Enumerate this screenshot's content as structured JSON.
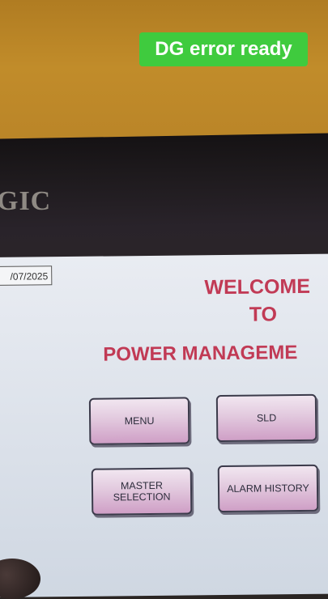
{
  "overlay": {
    "caption": "DG error ready"
  },
  "device": {
    "brand": "GIC"
  },
  "hmi": {
    "date": "/07/2025",
    "welcome_line1": "WELCOME",
    "welcome_line2": "TO",
    "welcome_line3": "POWER MANAGEME",
    "buttons": {
      "menu": "MENU",
      "sld": "SLD",
      "master_line1": "MASTER",
      "master_line2": "SELECTION",
      "alarm_history": "ALARM HISTORY"
    }
  },
  "colors": {
    "title": "#c13a55",
    "button_top": "#f1e6f0",
    "button_bottom": "#cf9fc6",
    "caption_bg": "#3fcb3e"
  }
}
